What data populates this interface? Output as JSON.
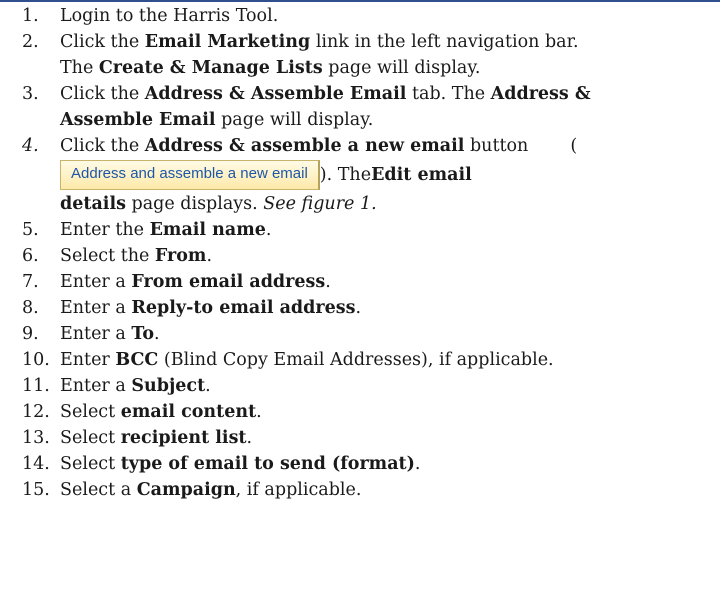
{
  "steps": [
    {
      "number": "1.",
      "parts": [
        "Login to the Harris Tool."
      ]
    },
    {
      "number": "2.",
      "line1_pre": "Click the ",
      "line1_bold": "Email Marketing",
      "line1_post": " link in the left navigation bar.",
      "line2_pre": "The ",
      "line2_bold": "Create & Manage Lists",
      "line2_post": " page will display."
    },
    {
      "number": "3.",
      "line1_pre": "Click the ",
      "line1_bold": "Address & Assemble Email",
      "line1_mid": " tab. The ",
      "line1_bold2": "Address &",
      "line2_bold": "Assemble Email",
      "line2_post": " page will display."
    },
    {
      "number": "4.",
      "line1_pre": "Click the ",
      "line1_bold": "Address & assemble a new email",
      "line1_post": " button",
      "paren_open": "(",
      "button_label": "Address and assemble a new email",
      "after_button": "). The ",
      "after_bold": "Edit email",
      "line3_bold": "details",
      "line3_post": " page displays. ",
      "fig_ref": "See figure 1."
    },
    {
      "number": "5.",
      "pre": "Enter the ",
      "bold": "Email name",
      "post": "."
    },
    {
      "number": "6.",
      "pre": "Select the ",
      "bold": "From",
      "post": "."
    },
    {
      "number": "7.",
      "pre": "Enter a ",
      "bold": "From email address",
      "post": "."
    },
    {
      "number": "8.",
      "pre": "Enter a ",
      "bold": "Reply-to email address",
      "post": "."
    },
    {
      "number": "9.",
      "pre": "Enter a ",
      "bold": "To",
      "post": "."
    },
    {
      "number": "10.",
      "pre": "Enter ",
      "bold": "BCC",
      "post": " (Blind Copy Email Addresses), if applicable."
    },
    {
      "number": "11.",
      "pre": "Enter a ",
      "bold": "Subject",
      "post": "."
    },
    {
      "number": "12.",
      "pre": "Select ",
      "bold": "email content",
      "post": "."
    },
    {
      "number": "13.",
      "pre": "Select ",
      "bold": "recipient list",
      "post": "."
    },
    {
      "number": "14.",
      "pre": "Select ",
      "bold": "type of email to send (format)",
      "post": "."
    },
    {
      "number": "15.",
      "pre": "Select a ",
      "bold": "Campaign",
      "post": ", if applicable."
    }
  ],
  "colors": {
    "rule": "#2f4f8f",
    "button_text": "#1e56a8",
    "button_bg_top": "#fffbe6",
    "button_bg_bottom": "#fde9a8"
  }
}
